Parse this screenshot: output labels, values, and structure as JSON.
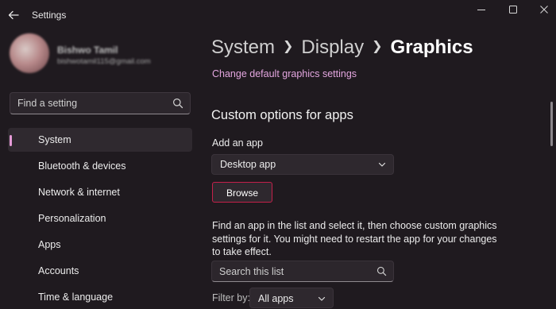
{
  "window": {
    "title": "Settings",
    "back_icon": "arrow-left-icon",
    "controls": [
      "minimize-icon",
      "maximize-icon",
      "close-icon"
    ]
  },
  "user": {
    "name": "Bishwo Tamil",
    "email": "bishwotamil115@gmail.com"
  },
  "search": {
    "placeholder": "Find a setting",
    "icon": "search-icon"
  },
  "sidebar": {
    "accent_color": "#e49ad6",
    "items": [
      {
        "label": "System",
        "active": true
      },
      {
        "label": "Bluetooth & devices"
      },
      {
        "label": "Network & internet"
      },
      {
        "label": "Personalization"
      },
      {
        "label": "Apps"
      },
      {
        "label": "Accounts"
      },
      {
        "label": "Time & language"
      }
    ]
  },
  "breadcrumb": {
    "items": [
      "System",
      "Display"
    ],
    "current": "Graphics"
  },
  "main": {
    "link": "Change default graphics settings",
    "link_color": "#e3a6df",
    "section_title": "Custom options for apps",
    "add_label": "Add an app",
    "app_type_value": "Desktop app",
    "browse_label": "Browse",
    "browse_border_color": "#c4204a",
    "info_text": "Find an app in the list and select it, then choose custom graphics settings for it. You might need to restart the app for your changes to take effect.",
    "list_search_placeholder": "Search this list",
    "filter_label": "Filter by:",
    "filter_value": "All apps"
  }
}
